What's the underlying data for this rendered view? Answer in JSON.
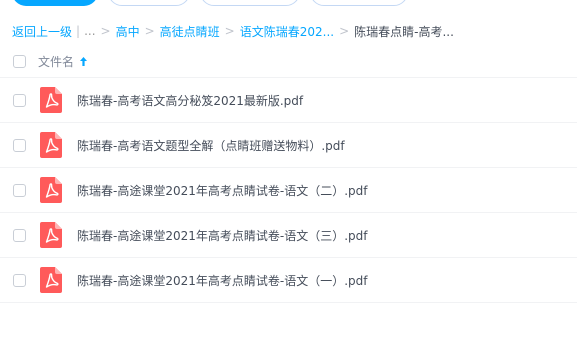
{
  "breadcrumb": {
    "back": "返回上一级",
    "separator": "|",
    "ellipsis": "...",
    "items": [
      "高中",
      "高徒点睛班",
      "语文陈瑞春202..."
    ],
    "current": "陈瑞春点睛-高考..."
  },
  "header": {
    "column_label": "文件名"
  },
  "files": [
    {
      "name": "陈瑞春-高考语文高分秘笈2021最新版.pdf",
      "icon": "pdf-icon"
    },
    {
      "name": "陈瑞春-高考语文题型全解（点睛班赠送物料）.pdf",
      "icon": "pdf-icon"
    },
    {
      "name": "陈瑞春-高途课堂2021年高考点睛试卷-语文（二）.pdf",
      "icon": "pdf-icon"
    },
    {
      "name": "陈瑞春-高途课堂2021年高考点睛试卷-语文（三）.pdf",
      "icon": "pdf-icon"
    },
    {
      "name": "陈瑞春-高途课堂2021年高考点睛试卷-语文（一）.pdf",
      "icon": "pdf-icon"
    }
  ],
  "colors": {
    "accent": "#06a7ff",
    "pdf_red": "#ff5a5a"
  }
}
